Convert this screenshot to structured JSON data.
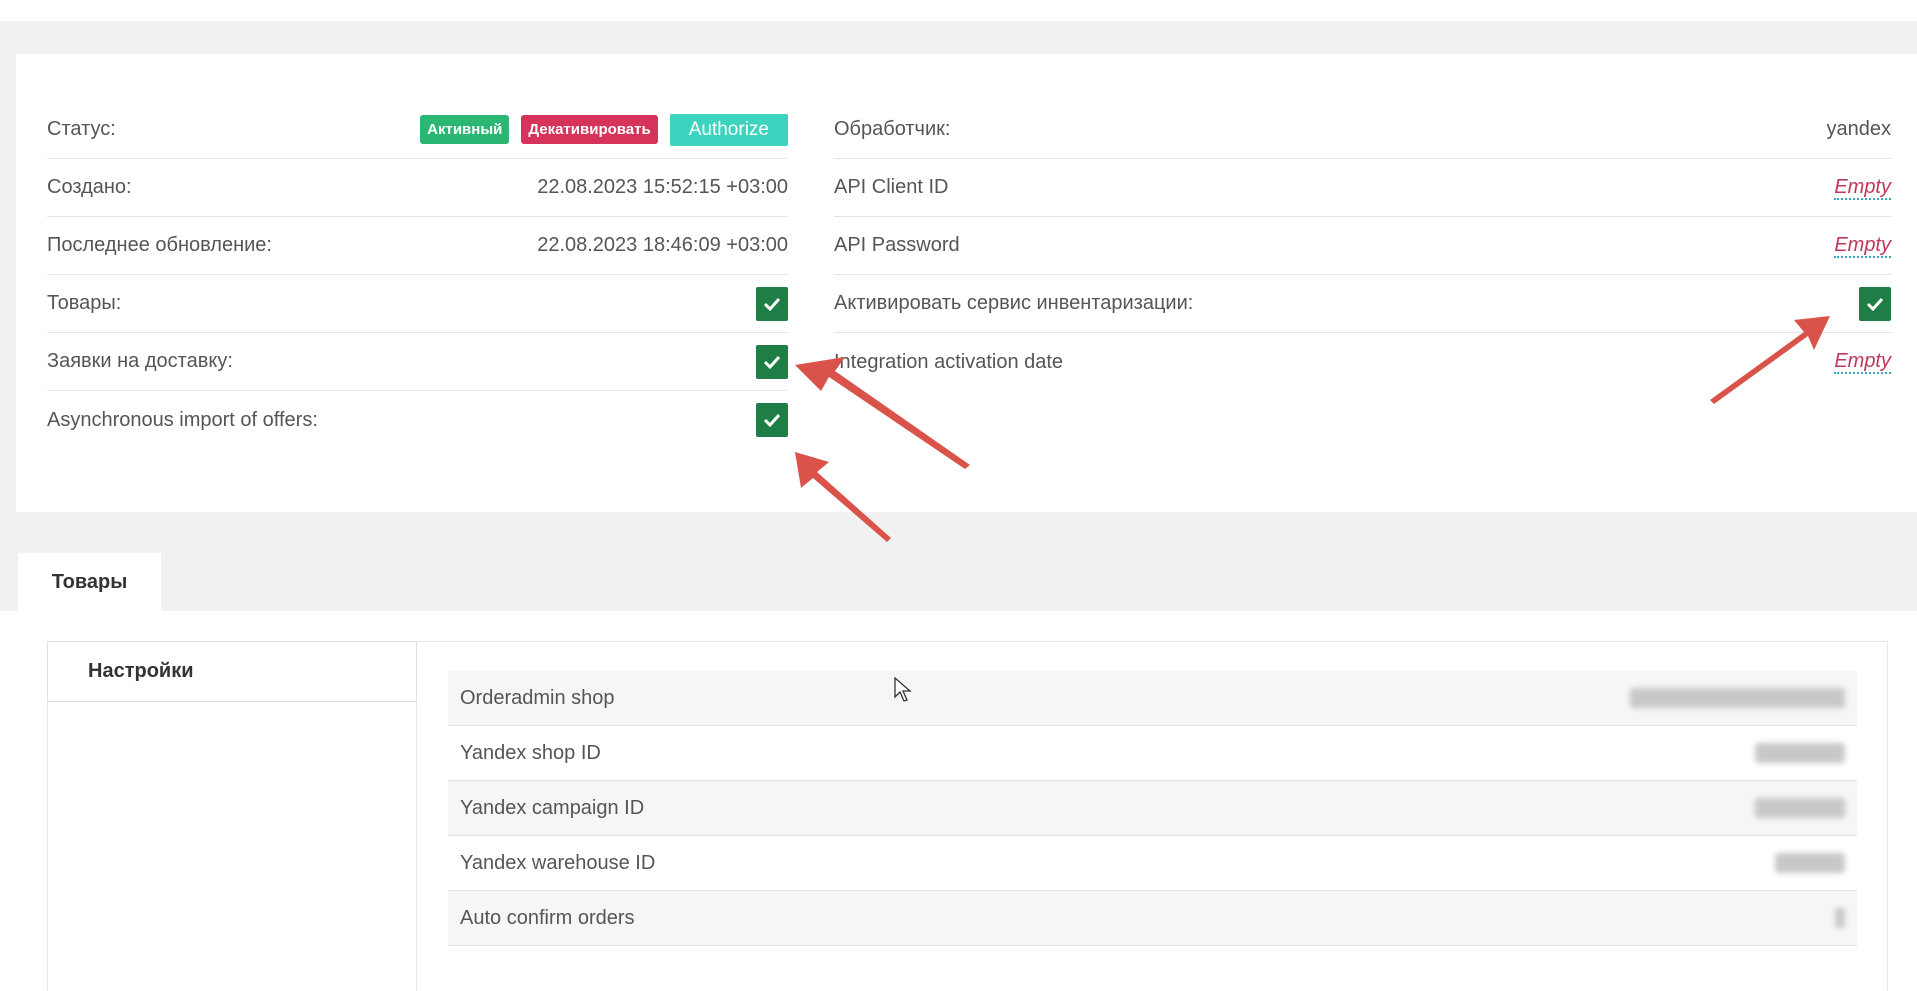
{
  "info_left": {
    "status_label": "Статус:",
    "status_badge_active": "Активный",
    "deactivate_button": "Декативировать",
    "authorize_button": "Authorize",
    "created_label": "Создано:",
    "created_value": "22.08.2023 15:52:15 +03:00",
    "updated_label": "Последнее обновление:",
    "updated_value": "22.08.2023 18:46:09 +03:00",
    "products_label": "Товары:",
    "products_checked": true,
    "delivery_label": "Заявки на доставку:",
    "delivery_checked": true,
    "async_label": "Asynchronous import of offers:",
    "async_checked": true
  },
  "info_right": {
    "handler_label": "Обработчик:",
    "handler_value": "yandex",
    "api_client_label": "API Client ID",
    "api_client_value": "Empty",
    "api_password_label": "API Password",
    "api_password_value": "Empty",
    "inventory_label": "Активировать сервис инвентаризации:",
    "inventory_checked": true,
    "integration_date_label": "Integration activation date",
    "integration_date_value": "Empty"
  },
  "tabs": {
    "products_tab": "Товары"
  },
  "subnav": {
    "settings": "Настройки"
  },
  "settings_table": [
    {
      "label": "Orderadmin shop"
    },
    {
      "label": "Yandex shop ID"
    },
    {
      "label": "Yandex campaign ID"
    },
    {
      "label": "Yandex warehouse ID"
    },
    {
      "label": "Auto confirm orders"
    }
  ],
  "colors": {
    "active_badge": "#2bb673",
    "deactivate_badge": "#d6335a",
    "authorize_button": "#3cd4bf",
    "checkbox": "#1f7e45",
    "empty_text": "#c0395a",
    "annotation_arrow": "#d9534a"
  },
  "icons": {
    "checkbox": "checkmark-icon",
    "cursor": "mouse-cursor-icon",
    "annotation": "red-arrow-annotation"
  }
}
